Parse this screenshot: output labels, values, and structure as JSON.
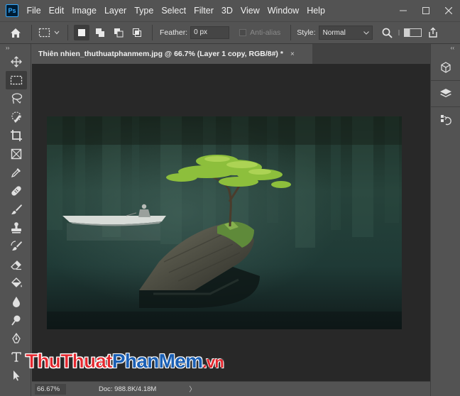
{
  "app": {
    "logo_text": "Ps"
  },
  "menu": [
    "File",
    "Edit",
    "Image",
    "Layer",
    "Type",
    "Select",
    "Filter",
    "3D",
    "View",
    "Window",
    "Help"
  ],
  "options": {
    "feather_label": "Feather:",
    "feather_value": "0 px",
    "antialias_label": "Anti-alias",
    "style_label": "Style:",
    "style_value": "Normal"
  },
  "document": {
    "tab_title": "Thiên nhien_thuthuatphanmem.jpg @ 66.7% (Layer 1 copy, RGB/8#) *",
    "close_glyph": "×"
  },
  "status": {
    "zoom": "66.67%",
    "doc_info": "Doc: 988.8K/4.18M",
    "arrow": "〉"
  },
  "watermark": {
    "part1": "ThuThuat",
    "part2": "PhanMem",
    "part3": ".vn"
  },
  "colors": {
    "bg": "#535353",
    "canvas": "#282828",
    "accent": "#31a8ff"
  }
}
